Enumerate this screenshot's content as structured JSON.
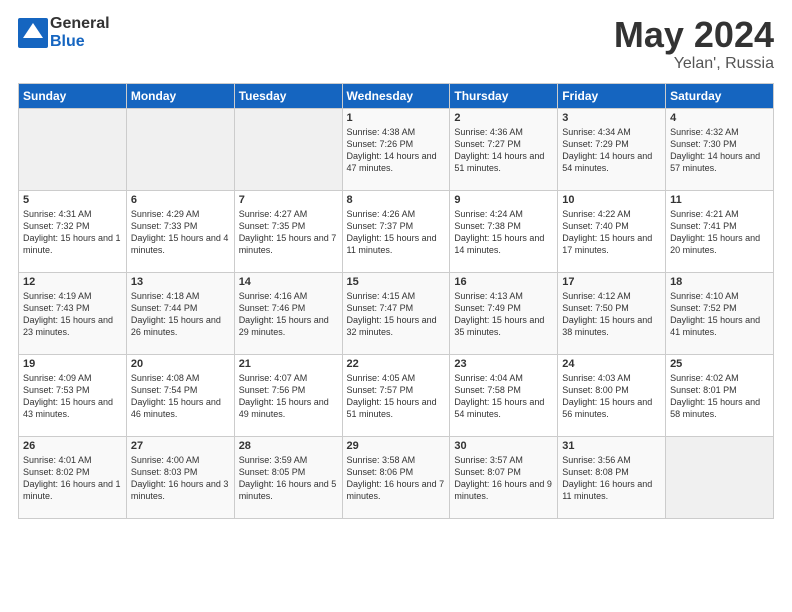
{
  "header": {
    "logo_general": "General",
    "logo_blue": "Blue",
    "month": "May 2024",
    "location": "Yelan', Russia"
  },
  "weekdays": [
    "Sunday",
    "Monday",
    "Tuesday",
    "Wednesday",
    "Thursday",
    "Friday",
    "Saturday"
  ],
  "weeks": [
    [
      {
        "day": "",
        "sunrise": "",
        "sunset": "",
        "daylight": ""
      },
      {
        "day": "",
        "sunrise": "",
        "sunset": "",
        "daylight": ""
      },
      {
        "day": "",
        "sunrise": "",
        "sunset": "",
        "daylight": ""
      },
      {
        "day": "1",
        "sunrise": "Sunrise: 4:38 AM",
        "sunset": "Sunset: 7:26 PM",
        "daylight": "Daylight: 14 hours and 47 minutes."
      },
      {
        "day": "2",
        "sunrise": "Sunrise: 4:36 AM",
        "sunset": "Sunset: 7:27 PM",
        "daylight": "Daylight: 14 hours and 51 minutes."
      },
      {
        "day": "3",
        "sunrise": "Sunrise: 4:34 AM",
        "sunset": "Sunset: 7:29 PM",
        "daylight": "Daylight: 14 hours and 54 minutes."
      },
      {
        "day": "4",
        "sunrise": "Sunrise: 4:32 AM",
        "sunset": "Sunset: 7:30 PM",
        "daylight": "Daylight: 14 hours and 57 minutes."
      }
    ],
    [
      {
        "day": "5",
        "sunrise": "Sunrise: 4:31 AM",
        "sunset": "Sunset: 7:32 PM",
        "daylight": "Daylight: 15 hours and 1 minute."
      },
      {
        "day": "6",
        "sunrise": "Sunrise: 4:29 AM",
        "sunset": "Sunset: 7:33 PM",
        "daylight": "Daylight: 15 hours and 4 minutes."
      },
      {
        "day": "7",
        "sunrise": "Sunrise: 4:27 AM",
        "sunset": "Sunset: 7:35 PM",
        "daylight": "Daylight: 15 hours and 7 minutes."
      },
      {
        "day": "8",
        "sunrise": "Sunrise: 4:26 AM",
        "sunset": "Sunset: 7:37 PM",
        "daylight": "Daylight: 15 hours and 11 minutes."
      },
      {
        "day": "9",
        "sunrise": "Sunrise: 4:24 AM",
        "sunset": "Sunset: 7:38 PM",
        "daylight": "Daylight: 15 hours and 14 minutes."
      },
      {
        "day": "10",
        "sunrise": "Sunrise: 4:22 AM",
        "sunset": "Sunset: 7:40 PM",
        "daylight": "Daylight: 15 hours and 17 minutes."
      },
      {
        "day": "11",
        "sunrise": "Sunrise: 4:21 AM",
        "sunset": "Sunset: 7:41 PM",
        "daylight": "Daylight: 15 hours and 20 minutes."
      }
    ],
    [
      {
        "day": "12",
        "sunrise": "Sunrise: 4:19 AM",
        "sunset": "Sunset: 7:43 PM",
        "daylight": "Daylight: 15 hours and 23 minutes."
      },
      {
        "day": "13",
        "sunrise": "Sunrise: 4:18 AM",
        "sunset": "Sunset: 7:44 PM",
        "daylight": "Daylight: 15 hours and 26 minutes."
      },
      {
        "day": "14",
        "sunrise": "Sunrise: 4:16 AM",
        "sunset": "Sunset: 7:46 PM",
        "daylight": "Daylight: 15 hours and 29 minutes."
      },
      {
        "day": "15",
        "sunrise": "Sunrise: 4:15 AM",
        "sunset": "Sunset: 7:47 PM",
        "daylight": "Daylight: 15 hours and 32 minutes."
      },
      {
        "day": "16",
        "sunrise": "Sunrise: 4:13 AM",
        "sunset": "Sunset: 7:49 PM",
        "daylight": "Daylight: 15 hours and 35 minutes."
      },
      {
        "day": "17",
        "sunrise": "Sunrise: 4:12 AM",
        "sunset": "Sunset: 7:50 PM",
        "daylight": "Daylight: 15 hours and 38 minutes."
      },
      {
        "day": "18",
        "sunrise": "Sunrise: 4:10 AM",
        "sunset": "Sunset: 7:52 PM",
        "daylight": "Daylight: 15 hours and 41 minutes."
      }
    ],
    [
      {
        "day": "19",
        "sunrise": "Sunrise: 4:09 AM",
        "sunset": "Sunset: 7:53 PM",
        "daylight": "Daylight: 15 hours and 43 minutes."
      },
      {
        "day": "20",
        "sunrise": "Sunrise: 4:08 AM",
        "sunset": "Sunset: 7:54 PM",
        "daylight": "Daylight: 15 hours and 46 minutes."
      },
      {
        "day": "21",
        "sunrise": "Sunrise: 4:07 AM",
        "sunset": "Sunset: 7:56 PM",
        "daylight": "Daylight: 15 hours and 49 minutes."
      },
      {
        "day": "22",
        "sunrise": "Sunrise: 4:05 AM",
        "sunset": "Sunset: 7:57 PM",
        "daylight": "Daylight: 15 hours and 51 minutes."
      },
      {
        "day": "23",
        "sunrise": "Sunrise: 4:04 AM",
        "sunset": "Sunset: 7:58 PM",
        "daylight": "Daylight: 15 hours and 54 minutes."
      },
      {
        "day": "24",
        "sunrise": "Sunrise: 4:03 AM",
        "sunset": "Sunset: 8:00 PM",
        "daylight": "Daylight: 15 hours and 56 minutes."
      },
      {
        "day": "25",
        "sunrise": "Sunrise: 4:02 AM",
        "sunset": "Sunset: 8:01 PM",
        "daylight": "Daylight: 15 hours and 58 minutes."
      }
    ],
    [
      {
        "day": "26",
        "sunrise": "Sunrise: 4:01 AM",
        "sunset": "Sunset: 8:02 PM",
        "daylight": "Daylight: 16 hours and 1 minute."
      },
      {
        "day": "27",
        "sunrise": "Sunrise: 4:00 AM",
        "sunset": "Sunset: 8:03 PM",
        "daylight": "Daylight: 16 hours and 3 minutes."
      },
      {
        "day": "28",
        "sunrise": "Sunrise: 3:59 AM",
        "sunset": "Sunset: 8:05 PM",
        "daylight": "Daylight: 16 hours and 5 minutes."
      },
      {
        "day": "29",
        "sunrise": "Sunrise: 3:58 AM",
        "sunset": "Sunset: 8:06 PM",
        "daylight": "Daylight: 16 hours and 7 minutes."
      },
      {
        "day": "30",
        "sunrise": "Sunrise: 3:57 AM",
        "sunset": "Sunset: 8:07 PM",
        "daylight": "Daylight: 16 hours and 9 minutes."
      },
      {
        "day": "31",
        "sunrise": "Sunrise: 3:56 AM",
        "sunset": "Sunset: 8:08 PM",
        "daylight": "Daylight: 16 hours and 11 minutes."
      },
      {
        "day": "",
        "sunrise": "",
        "sunset": "",
        "daylight": ""
      }
    ]
  ]
}
